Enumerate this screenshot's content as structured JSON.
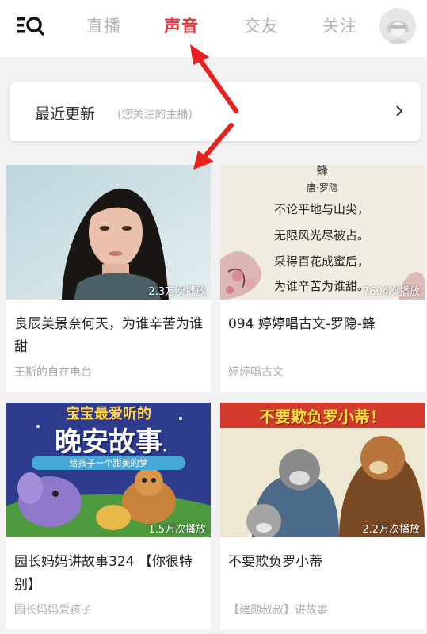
{
  "header": {
    "tabs": [
      {
        "label": "直播",
        "active": false
      },
      {
        "label": "声音",
        "active": true
      },
      {
        "label": "交友",
        "active": false
      },
      {
        "label": "关注",
        "active": false
      }
    ],
    "menu_icon": "search-menu-icon",
    "avatar_icon": "user-avatar-icon",
    "accent_color": "#e8373f"
  },
  "recent": {
    "title": "最近更新",
    "subtitle": "(您关注的主播)",
    "chevron_icon": "chevron-right-icon"
  },
  "cards": [
    {
      "title": "良辰美景奈何天，为谁辛苦为谁甜",
      "author": "王斯的自在电台",
      "plays": "2.3万次播放"
    },
    {
      "title": "094 婷婷唱古文-罗隐-蜂",
      "author": "婷婷唱古文",
      "plays": "7604次播放",
      "poem": {
        "heading": "蜂",
        "author": "唐·罗隐",
        "lines": [
          "不论平地与山尖，",
          "无限风光尽被占。",
          "采得百花成蜜后，",
          "为谁辛苦为谁甜。"
        ]
      }
    },
    {
      "title": "园长妈妈讲故事324 【你很特别】",
      "author": "园长妈妈爱孩子",
      "plays": "1.5万次播放",
      "cover": {
        "top": "宝宝最爱听的",
        "main": "晚安故事",
        "sub": "给孩子一个甜美的梦"
      }
    },
    {
      "title": "不要欺负罗小蒂",
      "author": "【建勋叔叔】讲故事",
      "plays": "2.2万次播放",
      "cover": {
        "main": "不要欺负罗小蒂！"
      }
    }
  ]
}
